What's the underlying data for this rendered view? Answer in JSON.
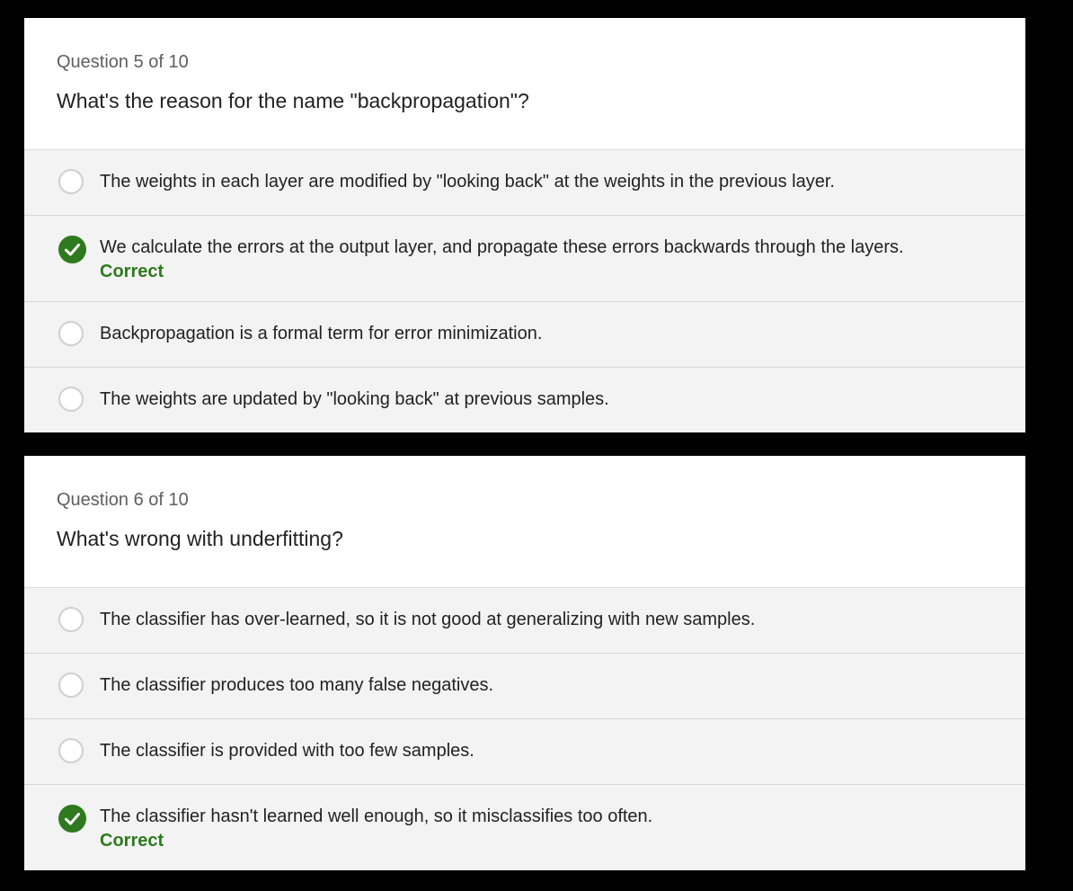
{
  "questions": [
    {
      "counter": "Question 5 of 10",
      "text": "What's the reason for the name \"backpropagation\"?",
      "options": [
        {
          "text": "The weights in each layer are modified by \"looking back\" at the weights in the previous layer.",
          "selected": false
        },
        {
          "text": "We calculate the errors at the output layer, and propagate these errors backwards through the layers.",
          "selected": true,
          "feedback": "Correct"
        },
        {
          "text": "Backpropagation is a formal term for error minimization.",
          "selected": false
        },
        {
          "text": "The weights are updated by \"looking back\" at previous samples.",
          "selected": false
        }
      ]
    },
    {
      "counter": "Question 6 of 10",
      "text": "What's wrong with underfitting?",
      "options": [
        {
          "text": "The classifier has over-learned, so it is not good at generalizing with new samples.",
          "selected": false
        },
        {
          "text": "The classifier produces too many false negatives.",
          "selected": false
        },
        {
          "text": "The classifier is provided with too few samples.",
          "selected": false
        },
        {
          "text": "The classifier hasn't learned well enough, so it misclassifies too often.",
          "selected": true,
          "feedback": "Correct"
        }
      ]
    }
  ],
  "colors": {
    "correct": "#2f7a1f",
    "option_bg": "#f3f3f3",
    "card_header_bg": "#ffffff",
    "page_bg": "#000000"
  },
  "icons": {
    "unselected": "radio-empty-icon",
    "selected": "checkmark-circle-icon"
  }
}
